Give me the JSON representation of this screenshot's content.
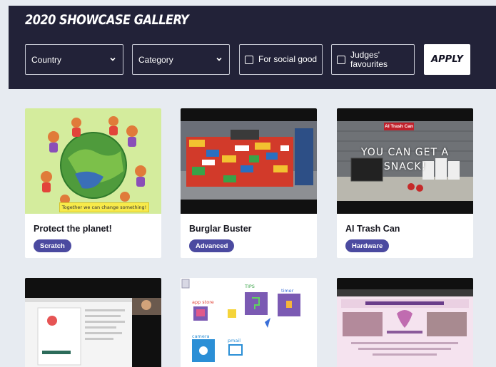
{
  "header": {
    "title": "2020 SHOWCASE GALLERY",
    "filters": {
      "country_placeholder": "Country",
      "category_placeholder": "Category",
      "social_good_label": "For social good",
      "judges_label_line1": "Judges'",
      "judges_label_line2": "favourites",
      "apply_label": "APPLY"
    }
  },
  "cards": [
    {
      "title": "Protect the planet!",
      "tag": "Scratch",
      "image_caption": "Together we can change something!"
    },
    {
      "title": "Burglar Buster",
      "tag": "Advanced"
    },
    {
      "title": "AI Trash Can",
      "tag": "Hardware",
      "overlay_line1": "YOU CAN GET A",
      "overlay_line2": "SNACK!",
      "sign_text": "AI Trash Can"
    },
    {
      "title": "",
      "tag": ""
    },
    {
      "title": "",
      "tag": "",
      "labels": {
        "tips": "TIPS",
        "app_store": "app store",
        "timer": "timer",
        "camera": "camera",
        "pmail": "pmail"
      }
    },
    {
      "title": "",
      "tag": ""
    }
  ],
  "colors": {
    "header_bg": "#222238",
    "page_bg": "#e7ebf1",
    "tag_bg": "#4b4aa0"
  }
}
